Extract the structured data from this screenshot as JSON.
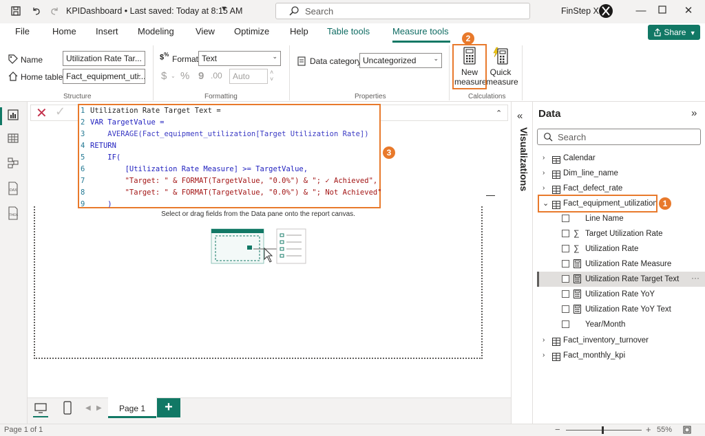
{
  "titlebar": {
    "file_name": "KPIDashboard",
    "separator": " • ",
    "saved_status": "Last saved: Today at 8:15 AM",
    "search_placeholder": "Search",
    "user": "FinStep X"
  },
  "ribbon_tabs": [
    "File",
    "Home",
    "Insert",
    "Modeling",
    "View",
    "Optimize",
    "Help",
    "Table tools",
    "Measure tools"
  ],
  "active_tab": "Measure tools",
  "share_label": "Share",
  "structure": {
    "name_label": "Name",
    "name_value": "Utilization Rate Tar...",
    "home_table_label": "Home table",
    "home_table_value": "Fact_equipment_uti...",
    "group_label": "Structure"
  },
  "formatting": {
    "format_label": "Format",
    "format_value": "Text",
    "currency_symbol": "$",
    "percent_symbol": "%",
    "comma_symbol": "9",
    "decimal_places": "Auto",
    "group_label": "Formatting"
  },
  "properties": {
    "data_category_label": "Data category",
    "data_category_value": "Uncategorized",
    "group_label": "Properties"
  },
  "calculations": {
    "new_measure_line1": "New",
    "new_measure_line2": "measure",
    "quick_measure_line1": "Quick",
    "quick_measure_line2": "measure",
    "group_label": "Calculations"
  },
  "badges": {
    "one": "1",
    "two": "2",
    "three": "3"
  },
  "formula": {
    "lines": [
      {
        "n": "1",
        "text": "Utilization Rate Target Text ="
      },
      {
        "n": "2",
        "text": "VAR TargetValue ="
      },
      {
        "n": "3",
        "text": "    AVERAGE(Fact_equipment_utilization[Target Utilization Rate])"
      },
      {
        "n": "4",
        "text": "RETURN"
      },
      {
        "n": "5",
        "text": "    IF("
      },
      {
        "n": "6",
        "text": "        [Utilization Rate Measure] >= TargetValue,"
      },
      {
        "n": "7",
        "text": "        \"Target: \" & FORMAT(TargetValue, \"0.0%\") & \"; ✓ Achieved\","
      },
      {
        "n": "8",
        "text": "        \"Target: \" & FORMAT(TargetValue, \"0.0%\") & \"; Not Achieved\""
      },
      {
        "n": "9",
        "text": "    )"
      }
    ]
  },
  "canvas_hint": "Select or drag fields from the Data pane onto the report canvas.",
  "page_tab": "Page 1",
  "add_page": "+",
  "status": {
    "page_info": "Page 1 of 1",
    "zoom_minus": "−",
    "zoom_plus": "+",
    "zoom": "55%"
  },
  "visualizations_label": "Visualizations",
  "data_pane": {
    "title": "Data",
    "search_placeholder": "Search",
    "tables": [
      {
        "name": "Calendar",
        "expanded": false
      },
      {
        "name": "Dim_line_name",
        "expanded": false
      },
      {
        "name": "Fact_defect_rate",
        "expanded": false
      },
      {
        "name": "Fact_equipment_utilization",
        "expanded": true
      },
      {
        "name": "Fact_inventory_turnover",
        "expanded": false
      },
      {
        "name": "Fact_monthly_kpi",
        "expanded": false
      }
    ],
    "fields": [
      {
        "name": "Line Name",
        "icon": "none"
      },
      {
        "name": "Target Utilization Rate",
        "icon": "sigma-icon"
      },
      {
        "name": "Utilization Rate",
        "icon": "sigma-icon"
      },
      {
        "name": "Utilization Rate Measure",
        "icon": "calculator-icon"
      },
      {
        "name": "Utilization Rate Target Text",
        "icon": "calculator-icon",
        "selected": true
      },
      {
        "name": "Utilization Rate YoY",
        "icon": "calculator-icon"
      },
      {
        "name": "Utilization Rate YoY Text",
        "icon": "calculator-icon"
      },
      {
        "name": "Year/Month",
        "icon": "none"
      }
    ],
    "more_options": "···"
  },
  "colors": {
    "accent": "#117865",
    "highlight": "#e8792b",
    "cancel": "#c4314b"
  }
}
